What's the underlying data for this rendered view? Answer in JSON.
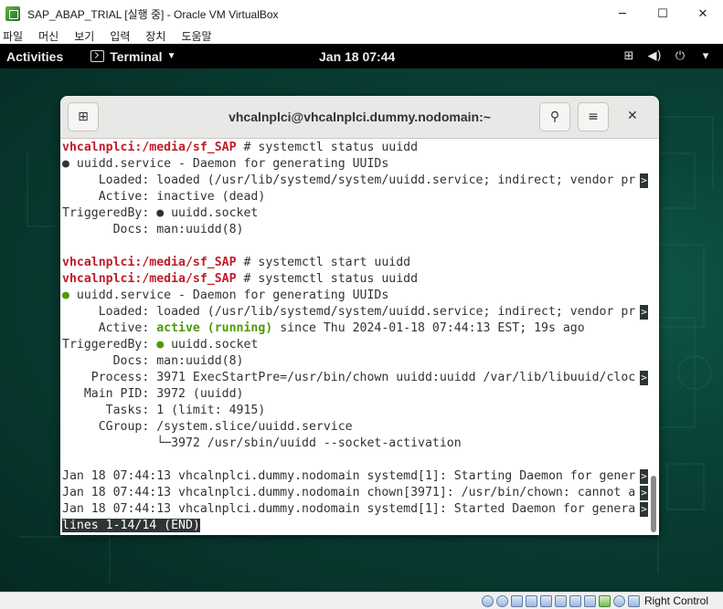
{
  "host": {
    "title": "SAP_ABAP_TRIAL [실행 중] - Oracle VM VirtualBox",
    "menu": [
      "파일",
      "머신",
      "보기",
      "입력",
      "장치",
      "도움말"
    ],
    "controls": {
      "minimize": "─",
      "maximize": "☐",
      "close": "✕"
    },
    "status_icons": [
      "hard-disk-icon",
      "optical-drive-icon",
      "audio-icon",
      "network-icon",
      "usb-icon",
      "shared-folders-icon",
      "display-icon",
      "video-capture-icon",
      "cpu-icon",
      "mouse-integration-icon",
      "keyboard-icon"
    ],
    "host_key": "Right Control"
  },
  "gnome": {
    "activities": "Activities",
    "app_name": "Terminal",
    "clock": "Jan 18  07:44",
    "tray": {
      "network": "⊞",
      "volume": "◀)",
      "power": "⏻",
      "menu": "▾"
    }
  },
  "terminal": {
    "title": "vhcalnplci@vhcalnplci.dummy.nodomain:~",
    "new_tab_icon": "⊞",
    "search_icon": "⚲",
    "menu_icon": "≡",
    "close_icon": "✕",
    "lines": [
      {
        "prompt": "vhcalnplci:/media/sf_SAP",
        "text": " # systemctl status uuidd"
      },
      {
        "text": "● uuidd.service - Daemon for generating UUIDs"
      },
      {
        "text": "     Loaded: loaded (/usr/lib/systemd/system/uuidd.service; indirect; vendor pr",
        "trunc": ">"
      },
      {
        "text": "     Active: inactive (dead)"
      },
      {
        "text": "TriggeredBy: ● uuidd.socket"
      },
      {
        "text": "       Docs: man:uuidd(8)"
      },
      {
        "text": ""
      },
      {
        "prompt": "vhcalnplci:/media/sf_SAP",
        "text": " # systemctl start uuidd"
      },
      {
        "prompt": "vhcalnplci:/media/sf_SAP",
        "text": " # systemctl status uuidd"
      },
      {
        "green_prefix": "●",
        "text": " uuidd.service - Daemon for generating UUIDs"
      },
      {
        "text": "     Loaded: loaded (/usr/lib/systemd/system/uuidd.service; indirect; vendor pr",
        "trunc": ">"
      },
      {
        "pre": "     Active: ",
        "green_bold": "active (running)",
        "text": " since Thu 2024-01-18 07:44:13 EST; 19s ago"
      },
      {
        "pre": "TriggeredBy: ",
        "green_prefix": "●",
        "text": " uuidd.socket"
      },
      {
        "text": "       Docs: man:uuidd(8)"
      },
      {
        "text": "    Process: 3971 ExecStartPre=/usr/bin/chown uuidd:uuidd /var/lib/libuuid/cloc",
        "trunc": ">"
      },
      {
        "text": "   Main PID: 3972 (uuidd)"
      },
      {
        "text": "      Tasks: 1 (limit: 4915)"
      },
      {
        "text": "     CGroup: /system.slice/uuidd.service"
      },
      {
        "text": "             └─3972 /usr/sbin/uuidd --socket-activation"
      },
      {
        "text": ""
      },
      {
        "text": "Jan 18 07:44:13 vhcalnplci.dummy.nodomain systemd[1]: Starting Daemon for gener",
        "trunc": ">"
      },
      {
        "text": "Jan 18 07:44:13 vhcalnplci.dummy.nodomain chown[3971]: /usr/bin/chown: cannot a",
        "trunc": ">"
      },
      {
        "text": "Jan 18 07:44:13 vhcalnplci.dummy.nodomain systemd[1]: Started Daemon for genera",
        "trunc": ">"
      },
      {
        "status": "lines 1-14/14 (END)"
      }
    ]
  },
  "colors": {
    "prompt": "#c01c28",
    "active_green": "#4e9a06",
    "desktop": "#0a4438",
    "topbar": "#000000"
  }
}
